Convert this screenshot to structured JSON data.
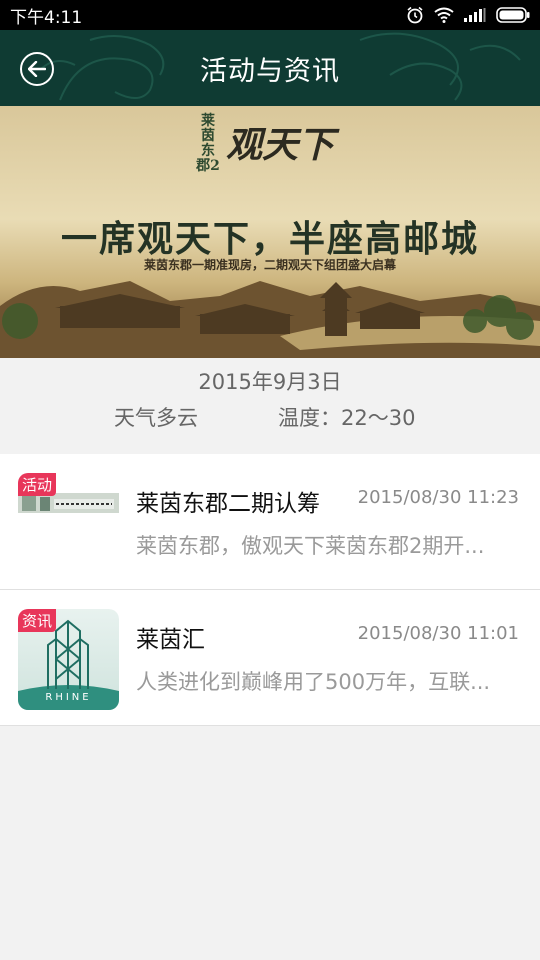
{
  "status_bar": {
    "time": "下午4:11",
    "icons": [
      "alarm-icon",
      "wifi-icon",
      "signal-icon",
      "battery-icon"
    ]
  },
  "header": {
    "title": "活动与资讯",
    "back_icon": "back-arrow-icon",
    "background": "#0f3b33"
  },
  "banner": {
    "logo_text": "莱茵东郡2",
    "title_small": "观天下",
    "slogan": "一席观天下，半座高邮城",
    "subtitle": "莱茵东郡一期准现房，二期观天下组团盛大启幕"
  },
  "info": {
    "date": "2015年9月3日",
    "weather": "天气多云",
    "temperature": "温度：22～30"
  },
  "items": [
    {
      "tag": "活动",
      "title": "莱茵东郡二期认筹",
      "time": "2015/08/30 11:23",
      "desc": "莱茵东郡，傲观天下莱茵东郡2期开..."
    },
    {
      "tag": "资讯",
      "title": "莱茵汇",
      "time": "2015/08/30 11:01",
      "desc": "人类进化到巅峰用了500万年，互联...",
      "logo_text": "RHINE"
    }
  ],
  "colors": {
    "tag": "#e8365a",
    "header": "#0f3b33",
    "page_bg": "#f2f2f2"
  }
}
